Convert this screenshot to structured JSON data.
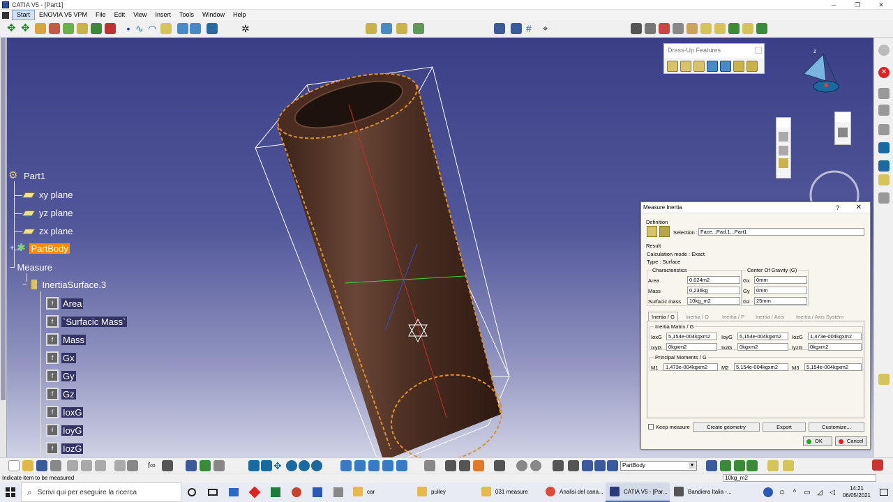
{
  "window": {
    "title": "CATIA V5 - [Part1]",
    "controls": [
      "─",
      "❐",
      "✕"
    ]
  },
  "menu": {
    "items": [
      "Start",
      "ENOVIA V5 VPM",
      "File",
      "Edit",
      "View",
      "Insert",
      "Tools",
      "Window",
      "Help"
    ]
  },
  "tree": {
    "root": "Part1",
    "nodes": [
      "xy plane",
      "yz plane",
      "zx plane",
      "PartBody",
      "Measure",
      "InertiaSurface.3"
    ],
    "params": [
      "Area",
      "`Surfacic Mass`",
      "Mass",
      "Gx",
      "Gy",
      "Gz",
      "IoxG",
      "IoyG",
      "IozG"
    ]
  },
  "dressup": {
    "title": "Dress-Up Features"
  },
  "dialog": {
    "title": "Measure Inertia",
    "help": "?",
    "close": "✕",
    "definition_label": "Definition",
    "selection_label": "Selection :",
    "selection_value": "Face...Pad.1...Part1",
    "result_label": "Result",
    "calc_mode": "Calculation mode :  Exact",
    "type": "Type :  Surface",
    "characteristics_label": "Characteristics",
    "cog_label": "Center Of Gravity (G)",
    "area_label": "Area",
    "area_value": "0,024m2",
    "mass_label": "Mass",
    "mass_value": "0,236kg",
    "surfmass_label": "Surfacic mass",
    "surfmass_value": "10kg_m2",
    "gx_label": "Gx",
    "gx_value": "0mm",
    "gy_label": "Gy",
    "gy_value": "0mm",
    "gz_label": "Gz",
    "gz_value": "25mm",
    "tabs": [
      "Inertia / G",
      "Inertia / O",
      "Inertia / P",
      "Inertia / Axis",
      "Inertia / Axis System"
    ],
    "matrix_label": "Inertia Matrix / G",
    "ioxg_label": "IoxG",
    "ioxg_value": "5,154e-004kgxm2",
    "ioyg_label": "IoyG",
    "ioyg_value": "5,154e-004kgxm2",
    "iozg_label": "IozG",
    "iozg_value": "1,473e-004kgxm2",
    "ixyg_label": "IxyG",
    "ixyg_value": "0kgxm2",
    "ixzg_label": "IxzG",
    "ixzg_value": "0kgxm2",
    "iyzg_label": "IyzG",
    "iyzg_value": "0kgxm2",
    "principal_label": "Principal Moments / G",
    "m1_label": "M1",
    "m1_value": "1,473e-004kgxm2",
    "m2_label": "M2",
    "m2_value": "5,154e-004kgxm2",
    "m3_label": "M3",
    "m3_value": "5,154e-004kgxm2",
    "keep_measure": "Keep measure",
    "create_geometry": "Create geometry",
    "export": "Export",
    "customize": "Customize...",
    "ok": "OK",
    "cancel": "Cancel"
  },
  "bottom": {
    "body_combo": "PartBody"
  },
  "status": {
    "message": "Indicate item to be measured",
    "command": "10kg_m2"
  },
  "taskbar": {
    "search_placeholder": "Scrivi qui per eseguire la ricerca",
    "items": [
      "car",
      "pulley",
      "031 measure",
      "Analisi del cana...",
      "CATIA V5 - [Par...",
      "Bandiera Italia -..."
    ],
    "time": "14:21",
    "date": "06/05/2021"
  },
  "colors": {
    "accent": "#ff8c00",
    "viewport_top": "#3b3f86",
    "tube": "#5a3a2c"
  }
}
